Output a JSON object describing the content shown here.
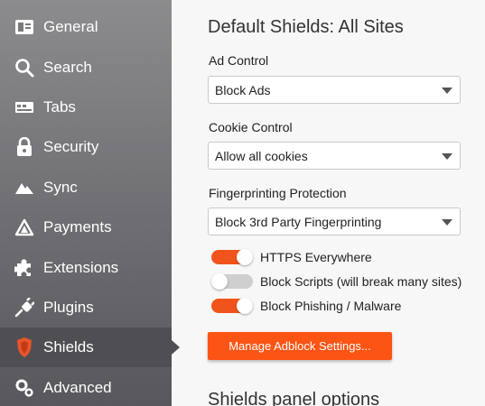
{
  "sidebar": {
    "items": [
      {
        "label": "General",
        "icon": "general-icon"
      },
      {
        "label": "Search",
        "icon": "search-icon"
      },
      {
        "label": "Tabs",
        "icon": "tabs-icon"
      },
      {
        "label": "Security",
        "icon": "lock-icon"
      },
      {
        "label": "Sync",
        "icon": "sync-icon"
      },
      {
        "label": "Payments",
        "icon": "payments-icon"
      },
      {
        "label": "Extensions",
        "icon": "puzzle-icon"
      },
      {
        "label": "Plugins",
        "icon": "plug-icon"
      },
      {
        "label": "Shields",
        "icon": "shield-icon",
        "active": true
      },
      {
        "label": "Advanced",
        "icon": "gear-icon"
      }
    ]
  },
  "main": {
    "section_title": "Default Shields: All Sites",
    "ad_control": {
      "label": "Ad Control",
      "value": "Block Ads"
    },
    "cookie_control": {
      "label": "Cookie Control",
      "value": "Allow all cookies"
    },
    "fingerprinting": {
      "label": "Fingerprinting Protection",
      "value": "Block 3rd Party Fingerprinting"
    },
    "toggles": [
      {
        "label": "HTTPS Everywhere",
        "on": true
      },
      {
        "label": "Block Scripts (will break many sites)",
        "on": false
      },
      {
        "label": "Block Phishing / Malware",
        "on": true
      }
    ],
    "manage_button": "Manage Adblock Settings...",
    "panel_section_title": "Shields panel options"
  },
  "colors": {
    "accent": "#fb5414",
    "toggle_on": "#f0541c",
    "toggle_off": "#cfcfcf",
    "shield_icon": "#e8552b",
    "sidebar_active": "#4f4f53"
  }
}
